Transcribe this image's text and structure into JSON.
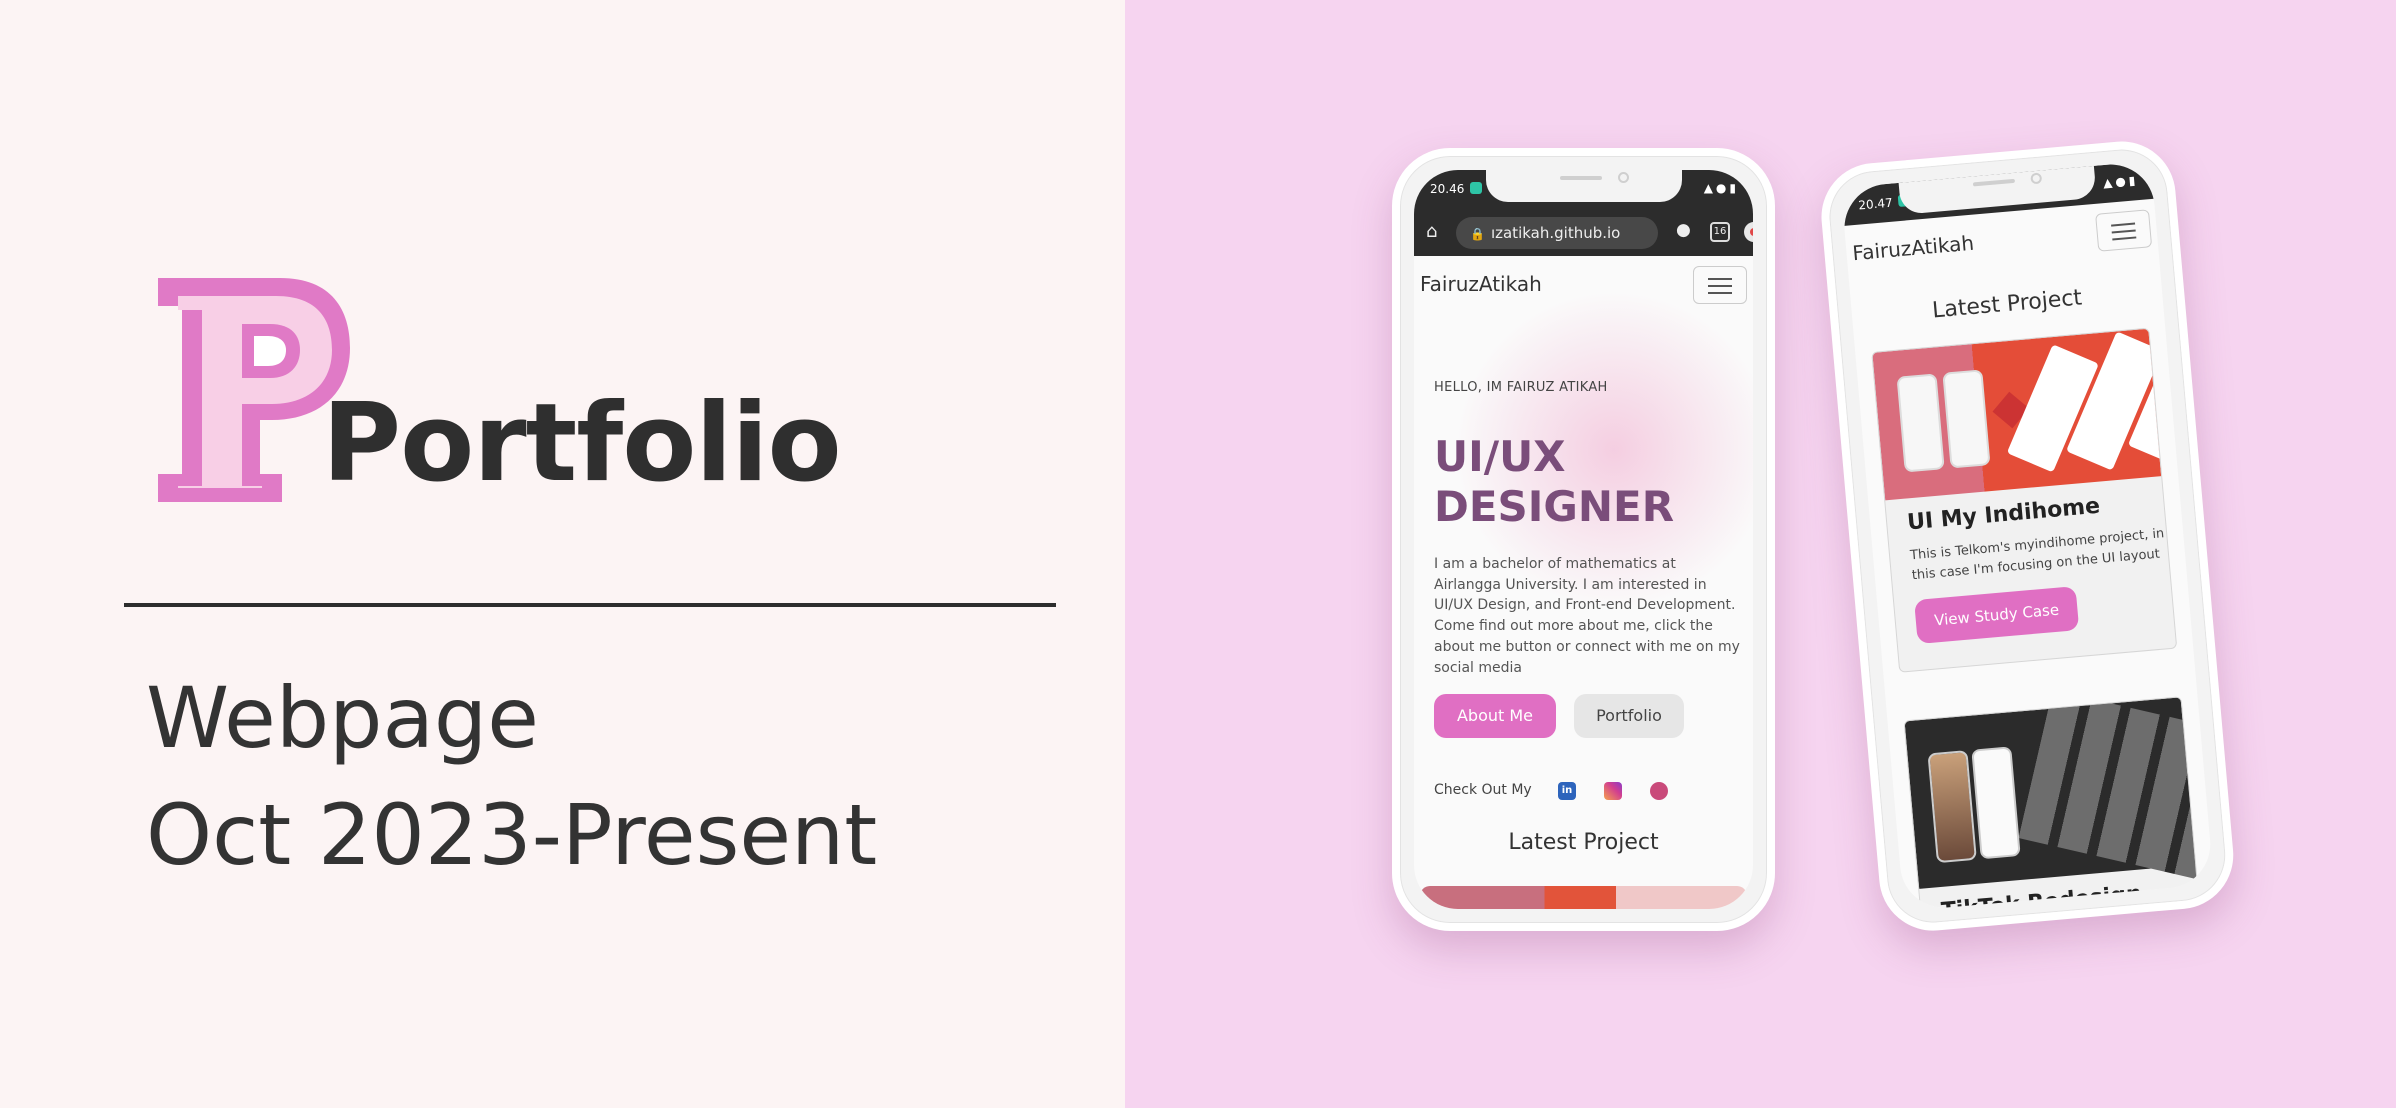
{
  "hero": {
    "title": "Portfolio",
    "subtitle_1": "Webpage",
    "subtitle_2": "Oct 2023-Present",
    "accent_color": "#e07ac6"
  },
  "front_phone": {
    "status_time": "20.46",
    "url": "ızatikah.github.io",
    "tab_count": "16",
    "brand": "FairuzAtikah",
    "greeting": "HELLO, IM FAIRUZ ATIKAH",
    "role": "UI/UX DESIGNER",
    "intro": "I am a bachelor of mathematics at Airlangga University. I am interested in UI/UX Design, and Front-end Development. Come find out more about me, click the about me button or connect with me on my social media",
    "btn_about": "About Me",
    "btn_portfolio": "Portfolio",
    "check_out": "Check Out My",
    "socials": [
      "linkedin-icon",
      "instagram-icon",
      "dribbble-icon"
    ],
    "latest": "Latest Project"
  },
  "back_phone": {
    "status_time": "20.47",
    "brand": "FairuzAtikah",
    "latest": "Latest Project",
    "projects": [
      {
        "title": "UI My Indihome",
        "text": "This is Telkom's myindihome project, in this case I'm focusing on the UI layout",
        "button": "View Study Case"
      },
      {
        "title": "TikTok Redesign"
      }
    ]
  },
  "colors": {
    "left_bg": "#fcf4f4",
    "right_bg": "#f6d4f0",
    "pink_button": "#e06fc3",
    "role_text": "#7a4d7a"
  }
}
